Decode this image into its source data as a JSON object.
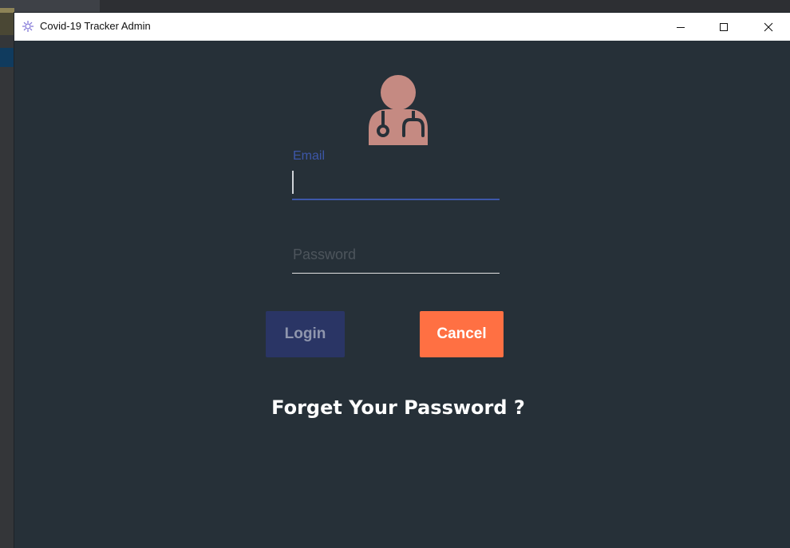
{
  "window": {
    "title": "Covid-19 Tracker Admin",
    "controls": {
      "minimize_icon": "minimize-icon",
      "maximize_icon": "maximize-icon",
      "close_icon": "close-icon"
    }
  },
  "login_form": {
    "avatar_icon": "doctor-icon",
    "email": {
      "label": "Email",
      "value": ""
    },
    "password": {
      "placeholder": "Password",
      "value": ""
    },
    "login_button": "Login",
    "cancel_button": "Cancel",
    "forgot_link": "Forget Your Password ?"
  },
  "colors": {
    "background": "#263038",
    "accent": "#3d57a9",
    "login_button": "#2a3565",
    "cancel_button": "#ff7043",
    "icon": "#c58a82"
  }
}
